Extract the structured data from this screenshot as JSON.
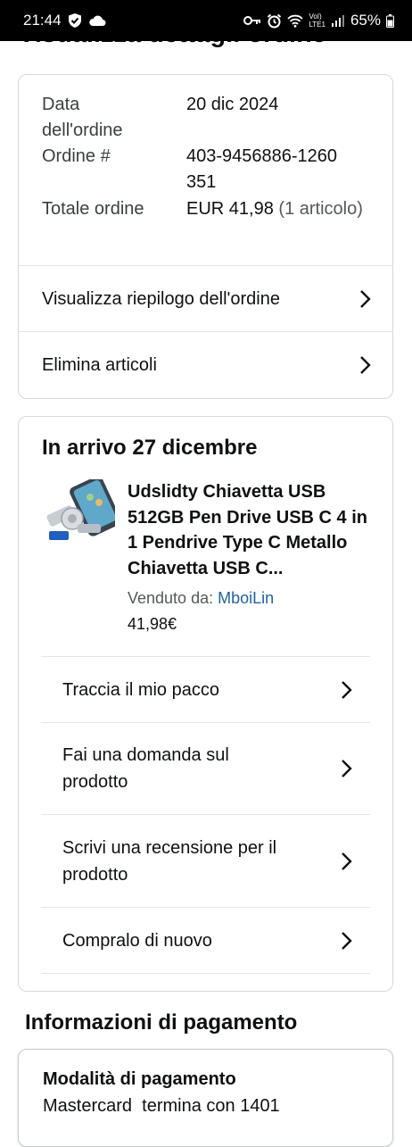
{
  "status_bar": {
    "time": "21:44",
    "network_small_top": "VoI)",
    "network_small_bottom": "LTE1",
    "battery": "65%",
    "icons": [
      "shield-icon",
      "cloud-icon",
      "key-icon",
      "alarm-icon",
      "wifi-icon",
      "signal-icon",
      "battery-icon"
    ]
  },
  "page": {
    "title": "Visualizza dettagli ordine"
  },
  "order_summary": {
    "date_label": "Data dell'ordine",
    "date_value": "20 dic 2024",
    "order_label": "Ordine #",
    "order_value": "403-9456886-1260351",
    "total_label": "Totale ordine",
    "total_value": "EUR 41,98",
    "total_items": "(1 articolo)",
    "links": [
      "Visualizza riepilogo dell'ordine",
      "Elimina articoli"
    ]
  },
  "shipment": {
    "arrival": "In arrivo 27 dicembre",
    "product_title": "Udslidty Chiavetta USB 512GB Pen Drive USB C 4 in 1 Pendrive Type C Metallo Chiavetta USB C...",
    "seller_label": "Venduto da:",
    "seller_name": "MboiLin",
    "price": "41,98€",
    "actions": [
      "Traccia il mio pacco",
      "Fai una domanda sul prodotto",
      "Scrivi una recensione per il prodotto",
      "Compralo di nuovo"
    ]
  },
  "payment": {
    "section_title": "Informazioni di pagamento",
    "method_label": "Modalità di pagamento",
    "method_value": "Mastercard  termina con 1401"
  },
  "colors": {
    "link": "#2162a1",
    "border": "#d5d9d9",
    "text": "#0f1111",
    "muted": "#565959"
  }
}
